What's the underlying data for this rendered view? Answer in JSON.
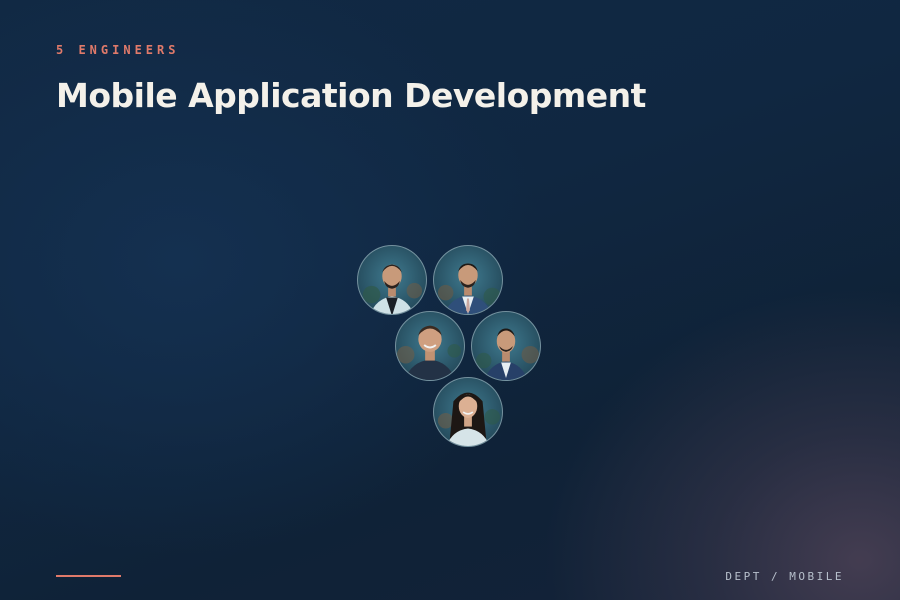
{
  "header": {
    "eyebrow": "5 ENGINEERS",
    "title": "Mobile Application Development"
  },
  "team": {
    "members": [
      {
        "photo": "portrait-man-beard-light-jacket"
      },
      {
        "photo": "portrait-man-beard-suit-tie"
      },
      {
        "photo": "portrait-man-smiling-dark-shirt"
      },
      {
        "photo": "portrait-man-beard-suit"
      },
      {
        "photo": "portrait-woman-long-dark-hair"
      }
    ]
  },
  "footer": {
    "tag": "DEPT / MOBILE"
  },
  "colors": {
    "accent": "#e07a6a",
    "title": "#f4f1ea",
    "background": "#112944"
  }
}
